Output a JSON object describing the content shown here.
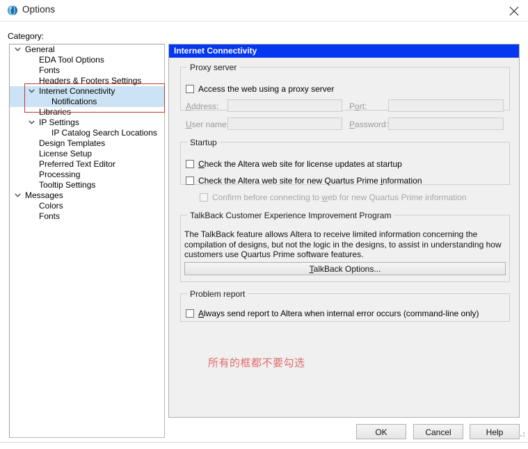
{
  "window": {
    "title": "Options",
    "icon": "quartus-sphere-icon",
    "close_label": "✕"
  },
  "category": {
    "label": "Category:",
    "tree": [
      {
        "label": "General",
        "level": 0,
        "twisty": "chevron-down",
        "selected": false
      },
      {
        "label": "EDA Tool Options",
        "level": 1,
        "twisty": "none",
        "selected": false
      },
      {
        "label": "Fonts",
        "level": 1,
        "twisty": "none",
        "selected": false
      },
      {
        "label": "Headers & Footers Settings",
        "level": 1,
        "twisty": "none",
        "selected": false
      },
      {
        "label": "Internet Connectivity",
        "level": 1,
        "twisty": "chevron-down",
        "selected": true
      },
      {
        "label": "Notifications",
        "level": 2,
        "twisty": "none",
        "selected": true
      },
      {
        "label": "Libraries",
        "level": 1,
        "twisty": "none",
        "selected": false
      },
      {
        "label": "IP Settings",
        "level": 1,
        "twisty": "chevron-down",
        "selected": false
      },
      {
        "label": "IP Catalog Search Locations",
        "level": 2,
        "twisty": "none",
        "selected": false
      },
      {
        "label": "Design Templates",
        "level": 1,
        "twisty": "none",
        "selected": false
      },
      {
        "label": "License Setup",
        "level": 1,
        "twisty": "none",
        "selected": false
      },
      {
        "label": "Preferred Text Editor",
        "level": 1,
        "twisty": "none",
        "selected": false
      },
      {
        "label": "Processing",
        "level": 1,
        "twisty": "none",
        "selected": false
      },
      {
        "label": "Tooltip Settings",
        "level": 1,
        "twisty": "none",
        "selected": false
      },
      {
        "label": "Messages",
        "level": 0,
        "twisty": "chevron-down",
        "selected": false
      },
      {
        "label": "Colors",
        "level": 1,
        "twisty": "none",
        "selected": false
      },
      {
        "label": "Fonts",
        "level": 1,
        "twisty": "none",
        "selected": false
      }
    ]
  },
  "panel": {
    "header": "Internet Connectivity",
    "proxy": {
      "group_title": "Proxy server",
      "checkbox_label": "Access the web using a proxy server",
      "checkbox_checked": false,
      "address_label": "Address:",
      "address_value": "",
      "port_label": "Port:",
      "port_value": "",
      "username_label": "User name:",
      "username_value": "",
      "password_label": "Password:",
      "password_value": ""
    },
    "startup": {
      "group_title": "Startup",
      "check_license_label": "Check the Altera web site for license updates at startup",
      "check_license_checked": false,
      "check_quartus_label": "Check the Altera web site for new Quartus Prime information",
      "check_quartus_checked": false,
      "confirm_label": "Confirm before connecting to web for new Quartus Prime information",
      "confirm_checked": false
    },
    "talkback": {
      "group_title": "TalkBack Customer Experience Improvement Program",
      "description": "The TalkBack feature allows Altera to receive limited information concerning the compilation of designs, but not the logic in the designs, to assist in understanding how customers use Quartus Prime software features.",
      "button_label": "TalkBack Options..."
    },
    "problem_report": {
      "group_title": "Problem report",
      "checkbox_label": "Always send report to Altera when internal error occurs (command-line only)",
      "checkbox_checked": false
    },
    "annotation_text": "所有的框都不要勾选"
  },
  "footer": {
    "ok_label": "OK",
    "cancel_label": "Cancel",
    "help_label": "Help"
  },
  "colors": {
    "header_blue": "#0536f0",
    "tree_selection": "#cce3f5",
    "annotation_red": "#c0392b",
    "annotation_text_red": "#e06b6b"
  }
}
